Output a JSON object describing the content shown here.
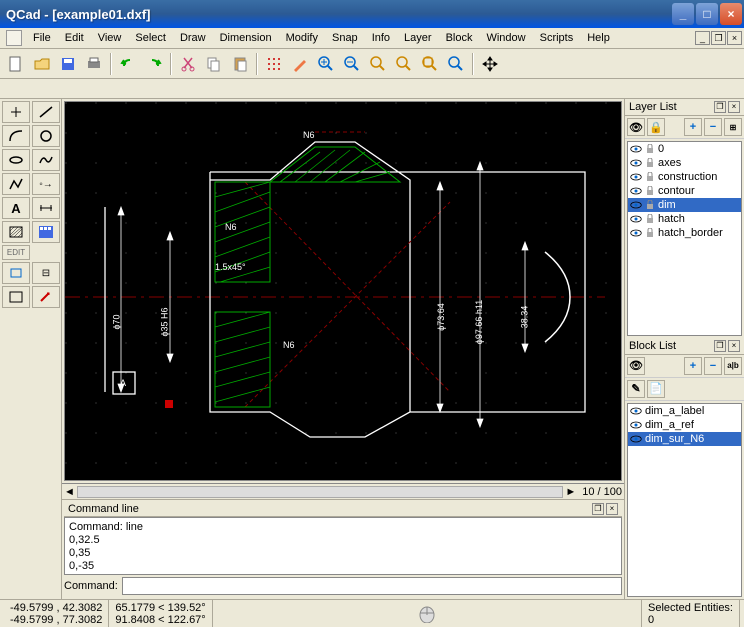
{
  "window": {
    "title": "QCad - [example01.dxf]"
  },
  "menu": [
    "File",
    "Edit",
    "View",
    "Select",
    "Draw",
    "Dimension",
    "Modify",
    "Snap",
    "Info",
    "Layer",
    "Block",
    "Window",
    "Scripts",
    "Help"
  ],
  "toolbar_icons": [
    "new",
    "open",
    "save",
    "print",
    "",
    "undo",
    "redo",
    "",
    "cut",
    "copy",
    "paste",
    "",
    "grid",
    "draft",
    "zoom-in",
    "zoom-out",
    "zoom-auto",
    "zoom-prev",
    "zoom-win",
    "zoom-pan",
    "",
    "move"
  ],
  "left_tools": [
    [
      "arrow",
      "line"
    ],
    [
      "arc",
      "circle"
    ],
    [
      "ellipse",
      "spline"
    ],
    [
      "polyline",
      "point"
    ],
    [
      "text",
      "dim"
    ],
    [
      "hatch",
      "image"
    ],
    [
      "edit",
      "modify"
    ],
    [
      "trim",
      "snap"
    ]
  ],
  "canvas": {
    "labels": {
      "n6a": "N6",
      "n6b": "N6",
      "n6c": "N6",
      "d15": "1.5x45°",
      "phi70": "ϕ70",
      "phi35": "ϕ35  H6",
      "phi73": "ϕ73.64",
      "phi97": "ϕ97.66  h11",
      "d38": "38.34",
      "a": "A"
    },
    "scroll_label": "10 / 100"
  },
  "layer_panel": {
    "title": "Layer List",
    "btns": [
      "+",
      "−",
      "⊞"
    ],
    "items": [
      {
        "name": "0",
        "sel": false
      },
      {
        "name": "axes",
        "sel": false
      },
      {
        "name": "construction",
        "sel": false
      },
      {
        "name": "contour",
        "sel": false
      },
      {
        "name": "dim",
        "sel": true
      },
      {
        "name": "hatch",
        "sel": false
      },
      {
        "name": "hatch_border",
        "sel": false
      }
    ]
  },
  "block_panel": {
    "title": "Block List",
    "btns": [
      "+",
      "−",
      "a|b"
    ],
    "items": [
      {
        "name": "dim_a_label",
        "sel": false
      },
      {
        "name": "dim_a_ref",
        "sel": false
      },
      {
        "name": "dim_sur_N6",
        "sel": true
      }
    ]
  },
  "command": {
    "title": "Command line",
    "log": [
      "Command: line",
      "0,32.5",
      "0,35",
      "0,-35"
    ],
    "prompt": "Command:"
  },
  "status": {
    "coord_abs": "-49.5799 , 42.3082",
    "coord_rel": "-49.5799 , 77.3082",
    "polar_abs": "65.1779 < 139.52°",
    "polar_rel": "91.8408 < 122.67°",
    "sel_label": "Selected Entities:",
    "sel_count": "0"
  },
  "colors": {
    "accent": "#316ac5"
  }
}
